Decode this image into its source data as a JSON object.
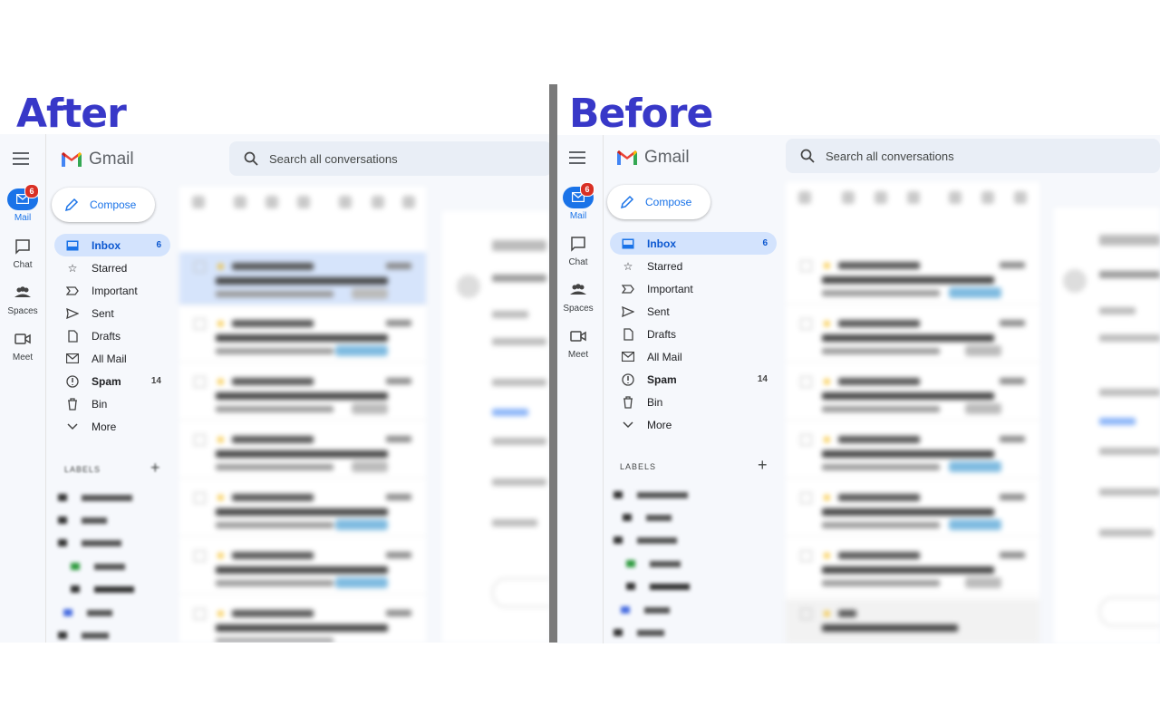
{
  "captions": {
    "after": "After",
    "before": "Before"
  },
  "gmail": {
    "brand": "Gmail",
    "search_placeholder": "Search all conversations",
    "compose_label": "Compose",
    "rail": [
      {
        "label": "Mail",
        "badge": "6"
      },
      {
        "label": "Chat"
      },
      {
        "label": "Spaces"
      },
      {
        "label": "Meet"
      }
    ],
    "nav": [
      {
        "label": "Inbox",
        "count": "6"
      },
      {
        "label": "Starred"
      },
      {
        "label": "Important"
      },
      {
        "label": "Sent"
      },
      {
        "label": "Drafts"
      },
      {
        "label": "All Mail"
      },
      {
        "label": "Spam",
        "count": "14"
      },
      {
        "label": "Bin"
      },
      {
        "label": "More"
      }
    ],
    "labels_heading": "LABELS",
    "labels_add": "+"
  },
  "colors": {
    "caption": "#3838c8",
    "selected_nav": "#d3e3fd",
    "accent": "#1a73e8",
    "badge": "#d93025"
  }
}
